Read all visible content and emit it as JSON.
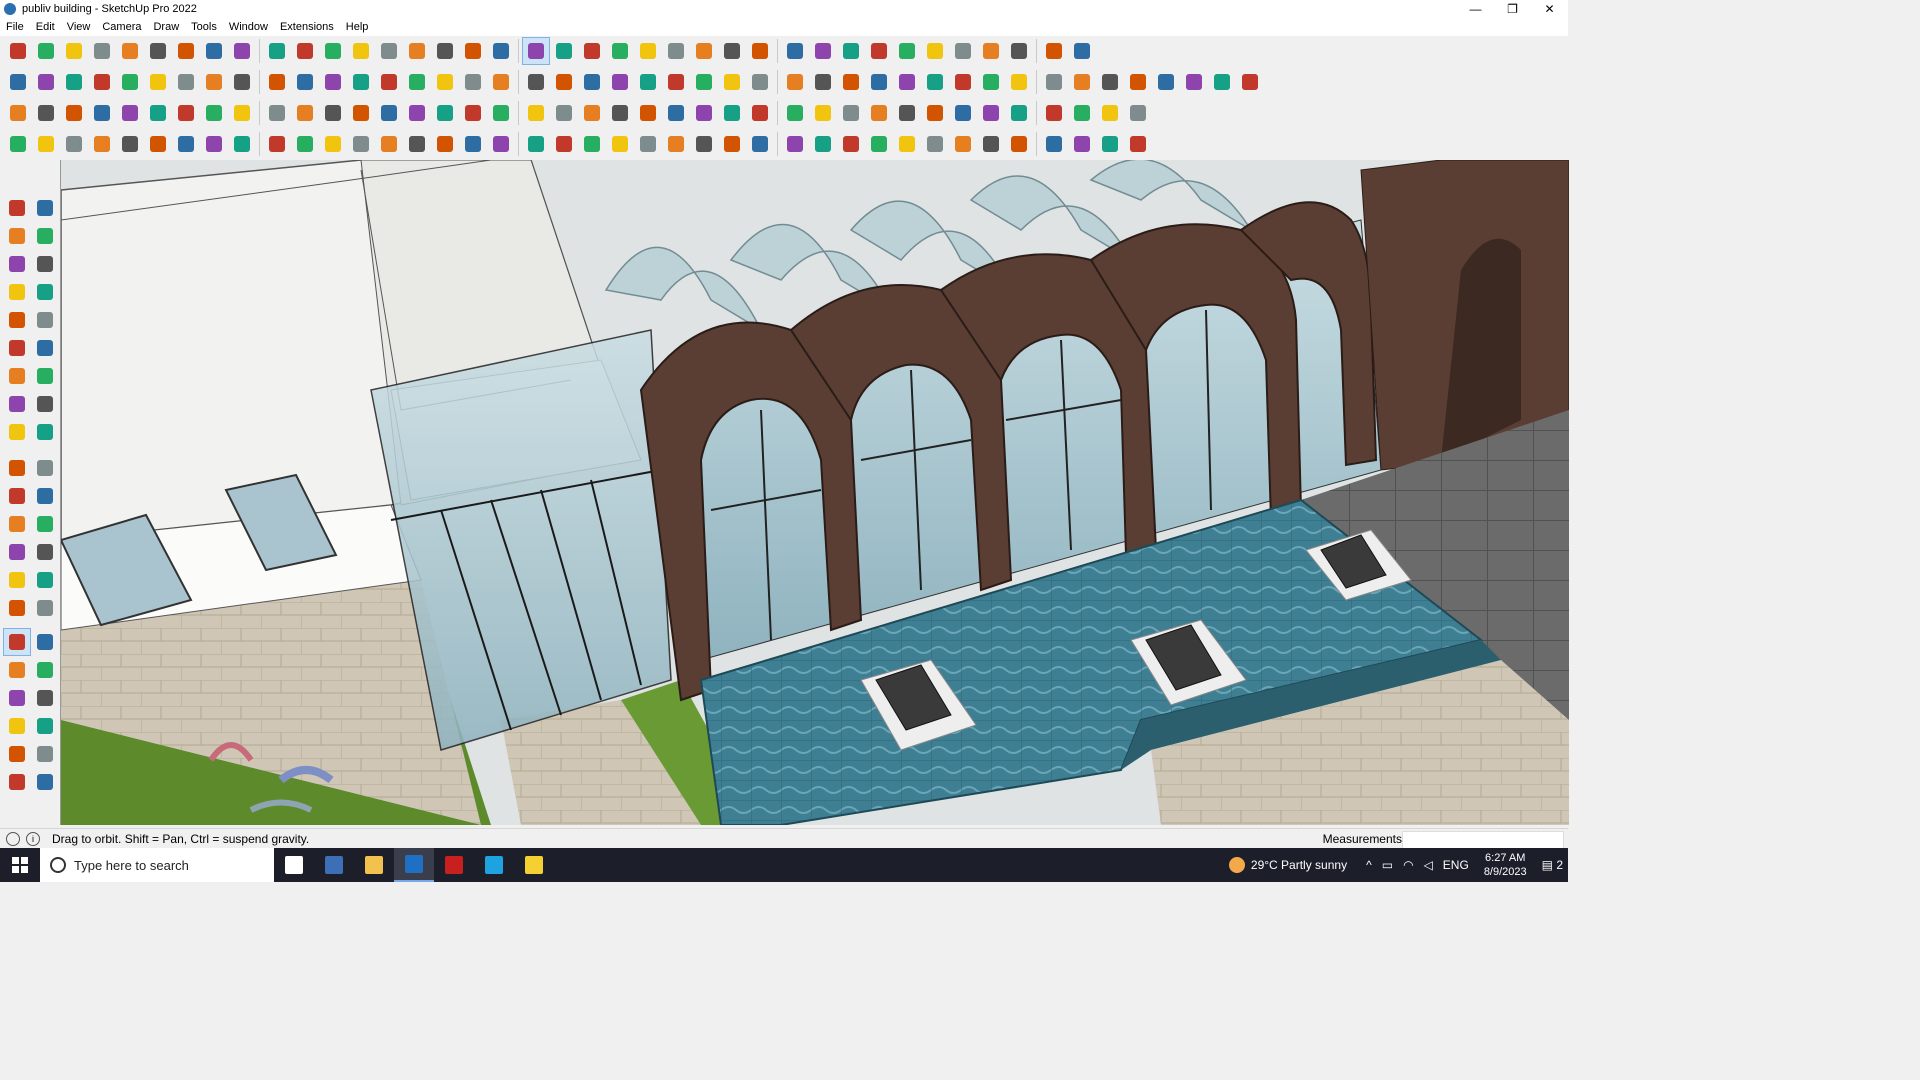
{
  "window": {
    "title": "publiv building - SketchUp Pro 2022",
    "controls": [
      "—",
      "❐",
      "✕"
    ]
  },
  "menu": [
    "File",
    "Edit",
    "View",
    "Camera",
    "Draw",
    "Tools",
    "Window",
    "Extensions",
    "Help"
  ],
  "toolbar_rows": [
    {
      "count": 38,
      "selected": 18
    },
    {
      "count": 44,
      "selected": -1
    },
    {
      "count": 40,
      "selected": -1
    },
    {
      "count": 40,
      "selected": -1
    }
  ],
  "toolbar_colors": [
    "#c0392b",
    "#2e6da4",
    "#e67e22",
    "#27ae60",
    "#8e44ad",
    "#555555",
    "#f1c40f",
    "#16a085",
    "#d35400",
    "#7f8c8d"
  ],
  "left_toolbar": {
    "rows": 21,
    "selected_row": 15
  },
  "status": {
    "hint": "Drag to orbit. Shift = Pan, Ctrl = suspend gravity.",
    "measurements_label": "Measurements",
    "measurements_value": ""
  },
  "taskbar": {
    "search_placeholder": "Type here to search",
    "apps": [
      "task-view",
      "calculator",
      "file-explorer",
      "sketchup",
      "autocad",
      "edge",
      "sticky-notes"
    ],
    "active_app": "sketchup",
    "app_colors": [
      "#ffffff",
      "#3d6fb6",
      "#f2c14e",
      "#1f6fc5",
      "#c8201e",
      "#1ea2e0",
      "#f5d033"
    ],
    "weather": "29°C  Partly sunny",
    "language": "ENG",
    "time": "6:27 AM",
    "date": "8/9/2023",
    "notifications": "2"
  }
}
